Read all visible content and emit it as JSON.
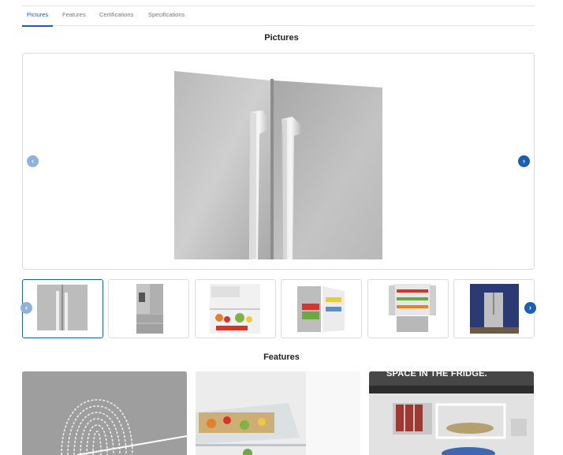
{
  "tabs": [
    {
      "label": "Pictures",
      "active": true
    },
    {
      "label": "Features",
      "active": false
    },
    {
      "label": "Certifications",
      "active": false
    },
    {
      "label": "Specifications",
      "active": false
    }
  ],
  "pictures": {
    "heading": "Pictures",
    "main_image": "refrigerator-door-handles-closeup",
    "prev_icon": "chevron-left-icon",
    "next_icon": "chevron-right-icon",
    "thumbnails": [
      {
        "subject": "door-handles-closeup",
        "selected": true
      },
      {
        "subject": "fridge-front-with-dispenser",
        "selected": false
      },
      {
        "subject": "interior-shelf-food",
        "selected": false
      },
      {
        "subject": "fridge-open-drawers",
        "selected": false
      },
      {
        "subject": "fridge-open-full",
        "selected": false
      },
      {
        "subject": "fridge-in-blue-kitchen",
        "selected": false
      }
    ]
  },
  "features": {
    "heading": "Features",
    "cards": [
      {
        "subject": "fingerprint-resistant-finish"
      },
      {
        "subject": "glass-shelf-with-food"
      },
      {
        "subject": "interior-space",
        "caption": "SPACE IN THE FRIDGE."
      }
    ]
  },
  "colors": {
    "accent": "#1a5fb4",
    "border": "#dcdcdc",
    "text": "#222222"
  }
}
